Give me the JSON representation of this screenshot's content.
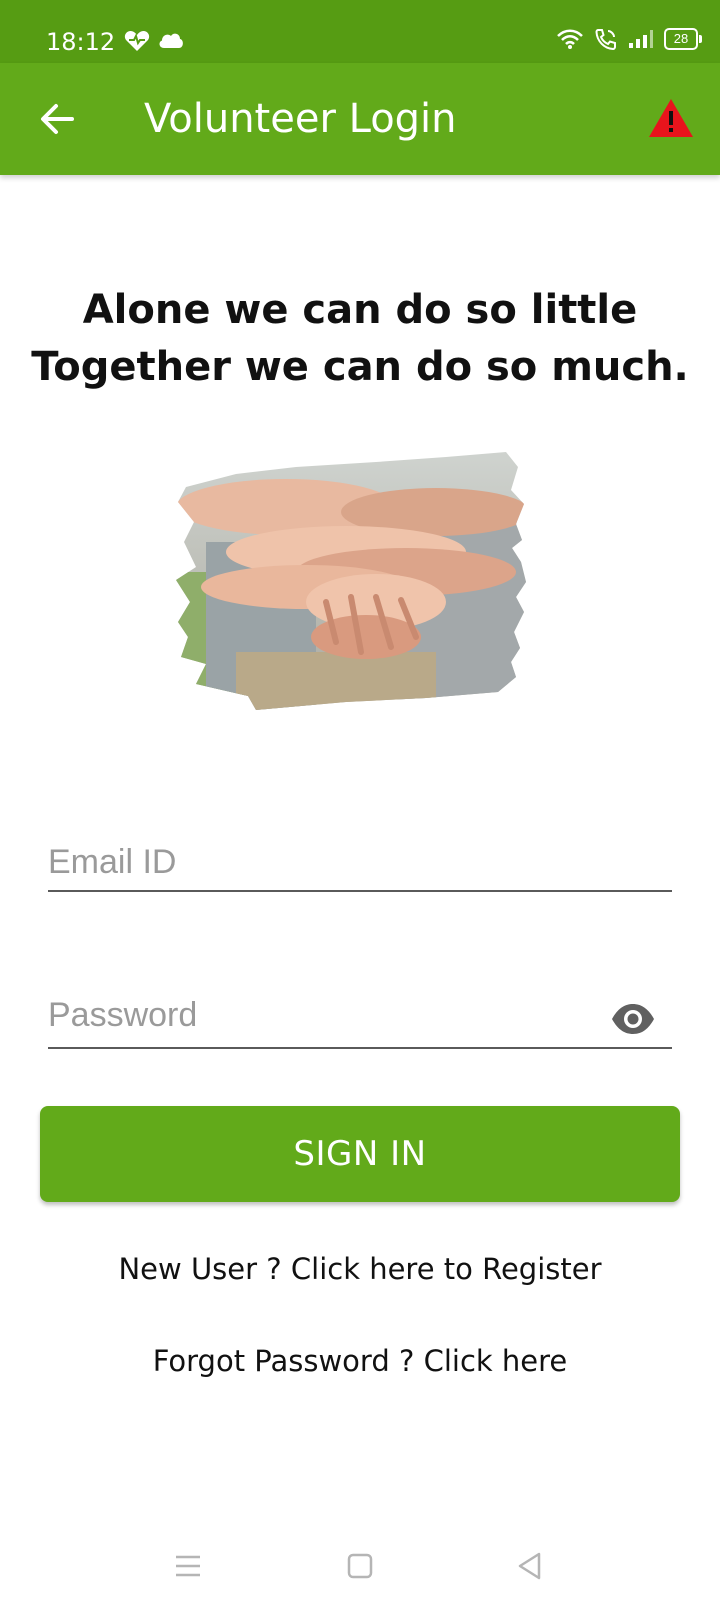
{
  "status_bar": {
    "time": "18:12",
    "battery": "28",
    "left_icons": [
      "health-heart-icon",
      "cloud-icon"
    ],
    "right_icons": [
      "wifi-icon",
      "wifi-calling-icon",
      "signal-icon",
      "battery-icon"
    ]
  },
  "app_bar": {
    "title": "Volunteer Login",
    "back_icon": "arrow-left-icon",
    "warning_icon": "warning-triangle-icon",
    "background": "#62aa1a"
  },
  "slogan": {
    "line1": "Alone we can do so little",
    "line2": "Together we can do so much."
  },
  "hero_image": "stacked-hands-image",
  "form": {
    "email": {
      "placeholder": "Email ID",
      "value": ""
    },
    "password": {
      "placeholder": "Password",
      "value": "",
      "toggle_icon": "eye-icon"
    },
    "signin_label": "SIGN IN"
  },
  "links": {
    "register": "New User ? Click here to Register",
    "forgot": "Forgot Password ? Click here"
  },
  "nav_bar": [
    "menu-icon",
    "home-square-icon",
    "back-triangle-icon"
  ],
  "colors": {
    "status_bar": "#569c13",
    "primary": "#62aa1a",
    "warning": "#e8141c"
  }
}
